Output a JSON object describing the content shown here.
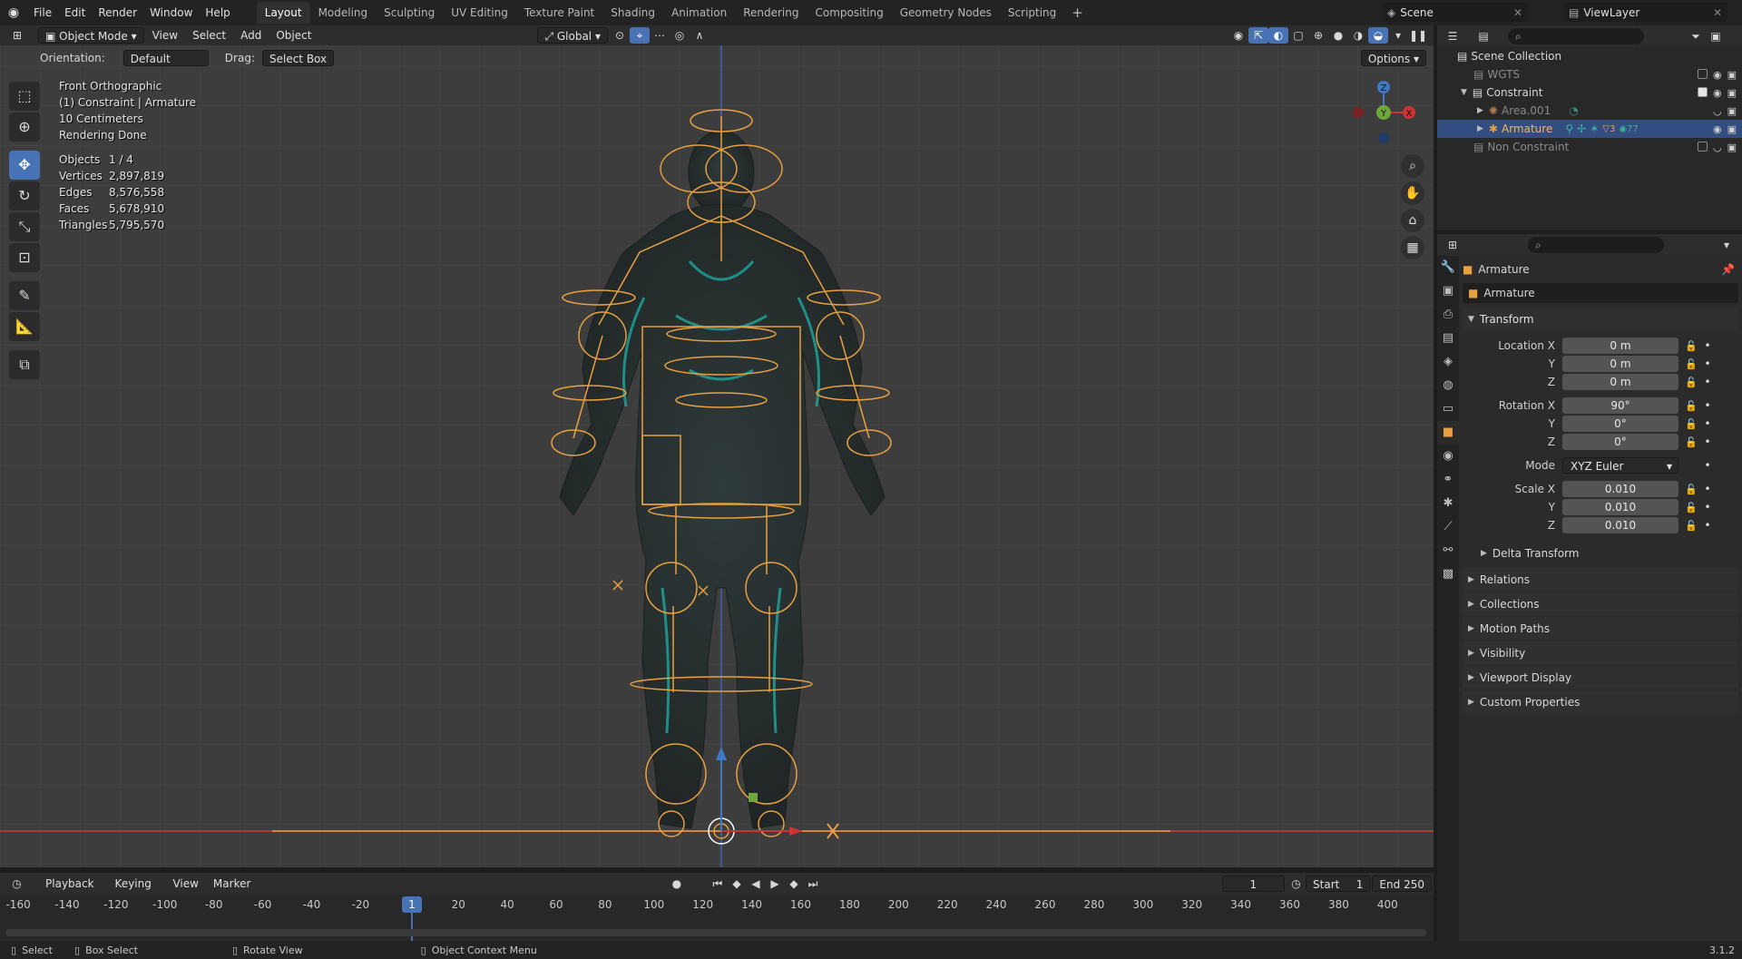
{
  "topbar": {
    "menus": [
      "File",
      "Edit",
      "Render",
      "Window",
      "Help"
    ],
    "workspaces": [
      "Layout",
      "Modeling",
      "Sculpting",
      "UV Editing",
      "Texture Paint",
      "Shading",
      "Animation",
      "Rendering",
      "Compositing",
      "Geometry Nodes",
      "Scripting"
    ],
    "active_workspace": "Layout",
    "scene": "Scene",
    "view_layer": "ViewLayer"
  },
  "viewport": {
    "mode": "Object Mode",
    "menus": [
      "View",
      "Select",
      "Add",
      "Object"
    ],
    "transform_orientation": "Global",
    "orientation_label": "Orientation:",
    "orientation_value": "Default",
    "drag_label": "Drag:",
    "drag_value": "Select Box",
    "options_label": "Options",
    "overlay_lines": [
      "Front Orthographic",
      "(1) Constraint | Armature",
      "10 Centimeters",
      "Rendering Done"
    ],
    "stats": [
      {
        "key": "Objects",
        "value": "1 / 4"
      },
      {
        "key": "Vertices",
        "value": "2,897,819"
      },
      {
        "key": "Edges",
        "value": "8,576,558"
      },
      {
        "key": "Faces",
        "value": "5,678,910"
      },
      {
        "key": "Triangles",
        "value": "5,795,570"
      }
    ],
    "gizmo_axes": {
      "x": "X",
      "y": "Y",
      "z": "Z"
    }
  },
  "timeline": {
    "menus": [
      "Playback",
      "Keying",
      "View",
      "Marker"
    ],
    "current_frame": "1",
    "start_label": "Start",
    "start": "1",
    "end_label": "End",
    "end": "250",
    "ticks": [
      "-160",
      "-140",
      "-120",
      "-100",
      "-80",
      "-60",
      "-40",
      "-20",
      "20",
      "40",
      "60",
      "80",
      "100",
      "120",
      "140",
      "160",
      "180",
      "200",
      "220",
      "240",
      "260",
      "280",
      "300",
      "320",
      "340",
      "360",
      "380",
      "400"
    ],
    "playhead": "1"
  },
  "statusbar": {
    "select": "Select",
    "box_select": "Box Select",
    "rotate_view": "Rotate View",
    "context_menu": "Object Context Menu",
    "version": "3.1.2"
  },
  "outliner": {
    "rows": [
      {
        "label": "Scene Collection"
      },
      {
        "label": "WGTS"
      },
      {
        "label": "Constraint"
      },
      {
        "label": "Area.001"
      },
      {
        "label": "Armature"
      },
      {
        "label": "Non Constraint"
      }
    ],
    "armature_badge_a": "3",
    "armature_badge_b": "77"
  },
  "properties": {
    "object_name": "Armature",
    "object_datablock": "Armature",
    "transform_label": "Transform",
    "location": {
      "x_label": "Location X",
      "y_label": "Y",
      "z_label": "Z",
      "x": "0 m",
      "y": "0 m",
      "z": "0 m"
    },
    "rotation": {
      "x_label": "Rotation X",
      "y_label": "Y",
      "z_label": "Z",
      "x": "90°",
      "y": "0°",
      "z": "0°"
    },
    "mode_label": "Mode",
    "mode_value": "XYZ Euler",
    "scale": {
      "x_label": "Scale X",
      "y_label": "Y",
      "z_label": "Z",
      "x": "0.010",
      "y": "0.010",
      "z": "0.010"
    },
    "delta_transform": "Delta Transform",
    "panels": [
      "Relations",
      "Collections",
      "Motion Paths",
      "Visibility",
      "Viewport Display",
      "Custom Properties"
    ]
  },
  "colors": {
    "accent": "#4772b3",
    "bone_orange": "#e8a040",
    "axis_red": "#cc3333",
    "axis_green": "#6fa83a",
    "axis_blue": "#3f78c4"
  }
}
